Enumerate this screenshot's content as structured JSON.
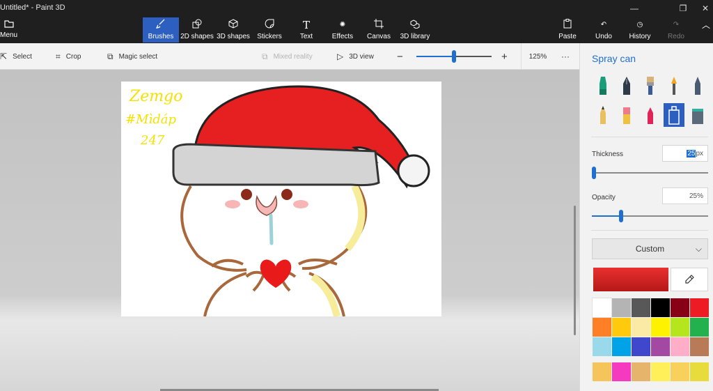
{
  "window": {
    "title": "Untitled* - Paint 3D"
  },
  "menu": {
    "label": "Menu"
  },
  "tabs": [
    {
      "key": "brushes",
      "label": "Brushes",
      "icon": "brush-icon",
      "active": true
    },
    {
      "key": "2d-shapes",
      "label": "2D shapes",
      "icon": "2d-shapes-icon"
    },
    {
      "key": "3d-shapes",
      "label": "3D shapes",
      "icon": "3d-shapes-icon"
    },
    {
      "key": "stickers",
      "label": "Stickers",
      "icon": "sticker-icon"
    },
    {
      "key": "text",
      "label": "Text",
      "icon": "text-icon"
    },
    {
      "key": "effects",
      "label": "Effects",
      "icon": "effects-icon"
    },
    {
      "key": "canvas",
      "label": "Canvas",
      "icon": "canvas-icon"
    },
    {
      "key": "3d-library",
      "label": "3D library",
      "icon": "3d-library-icon"
    }
  ],
  "actions": {
    "paste": "Paste",
    "undo": "Undo",
    "history": "History",
    "redo": "Redo"
  },
  "toolbar": {
    "select": "Select",
    "crop": "Crop",
    "magic_select": "Magic select",
    "mixed_reality": "Mixed reality",
    "view_3d": "3D view",
    "zoom_minus": "−",
    "zoom_plus": "+",
    "zoom_level": "125%",
    "zoom_fraction": 0.5,
    "more": "···"
  },
  "canvas": {
    "handwriting_lines": [
      "Zemgo",
      "#Mìdáp",
      "247"
    ]
  },
  "panel": {
    "title": "Spray can",
    "brushes": [
      "marker-icon",
      "calligraphy-pen-icon",
      "oil-brush-icon",
      "watercolor-icon",
      "pixel-pen-icon",
      "pencil-icon",
      "eraser-icon",
      "crayon-icon",
      "spray-can-icon",
      "fill-bucket-icon"
    ],
    "thickness_label": "Thickness",
    "thickness_value": "25",
    "thickness_unit": "px",
    "thickness_fraction": 0.02,
    "opacity_label": "Opacity",
    "opacity_value": "25%",
    "opacity_fraction": 0.25,
    "color_mode": "Custom",
    "current_color": "#d9262a",
    "palette": [
      "#ffffff",
      "#b4b4b4",
      "#585858",
      "#000000",
      "#880015",
      "#ed1c24",
      "#ff7f27",
      "#ffc90e",
      "#fbe9a6",
      "#fff200",
      "#b5e61d",
      "#22b14c",
      "#99d9ea",
      "#00a2e8",
      "#3f48cc",
      "#a349a4",
      "#ffaec9",
      "#b97a57"
    ],
    "custom_palette": [
      "#f5c45a",
      "#f53ac0",
      "#e6b46a",
      "#fff05a",
      "#f8d05c",
      "#e8dc3c"
    ]
  }
}
